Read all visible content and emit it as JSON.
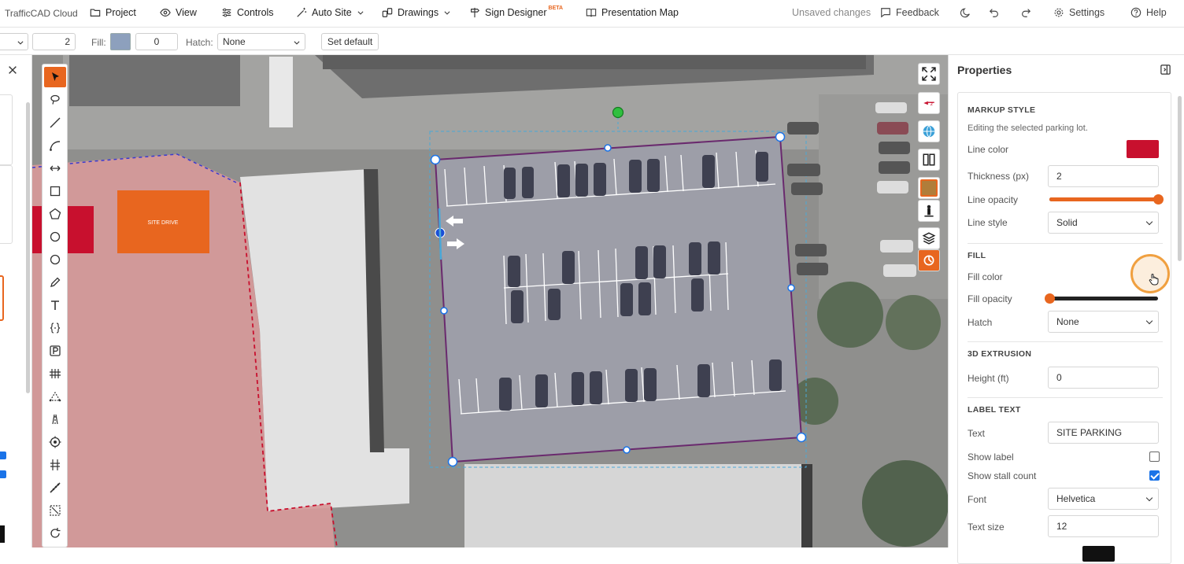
{
  "app": {
    "brand": "TrafficCAD Cloud"
  },
  "menu": {
    "project": "Project",
    "view": "View",
    "controls": "Controls",
    "auto_site": "Auto Site",
    "drawings": "Drawings",
    "sign_designer": "Sign Designer",
    "sign_designer_badge": "BETA",
    "presentation_map": "Presentation Map"
  },
  "topright": {
    "status": "Unsaved changes",
    "feedback": "Feedback",
    "settings": "Settings",
    "help": "Help"
  },
  "toolbar": {
    "line_width_value": "2",
    "fill_label": "Fill:",
    "fill_color": "#8da0bd",
    "fill_value": "0",
    "hatch_label": "Hatch:",
    "hatch_value": "None",
    "set_default": "Set default"
  },
  "canvas": {
    "site_label": "SITE DRIVE",
    "accent_color": "#e8661f"
  },
  "properties": {
    "title": "Properties",
    "markup_style": {
      "heading": "MARKUP STYLE",
      "subtitle": "Editing the selected parking lot.",
      "line_color_label": "Line color",
      "line_color": "#c8102e",
      "thickness_label": "Thickness (px)",
      "thickness_value": "2",
      "line_opacity_label": "Line opacity",
      "line_opacity": 1.0,
      "line_style_label": "Line style",
      "line_style_value": "Solid"
    },
    "fill": {
      "heading": "FILL",
      "fill_color_label": "Fill color",
      "fill_color": "#8a8a8a",
      "fill_opacity_label": "Fill opacity",
      "fill_opacity": 0.0,
      "hatch_label": "Hatch",
      "hatch_value": "None"
    },
    "extrusion": {
      "heading": "3D EXTRUSION",
      "height_label": "Height (ft)",
      "height_value": "0"
    },
    "label_text": {
      "heading": "LABEL TEXT",
      "text_label": "Text",
      "text_value": "SITE PARKING",
      "show_label_label": "Show label",
      "show_label": false,
      "show_stall_count_label": "Show stall count",
      "show_stall_count": true,
      "font_label": "Font",
      "font_value": "Helvetica",
      "text_size_label": "Text size",
      "text_size_value": "12"
    }
  }
}
